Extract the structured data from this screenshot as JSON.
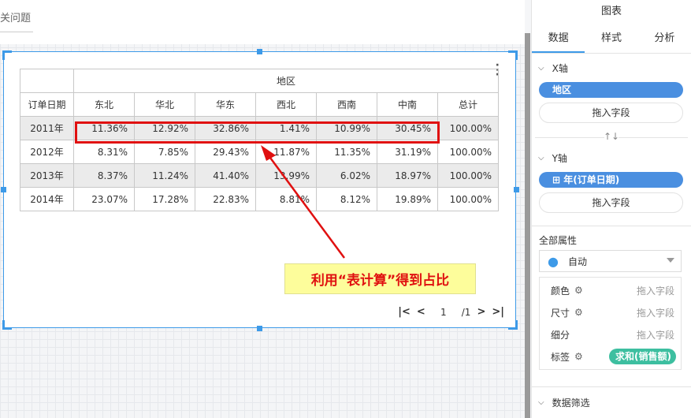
{
  "topbar": {
    "tab_label": "关问题"
  },
  "table": {
    "row_header": "订单日期",
    "column_group": "地区",
    "regions": [
      "东北",
      "华北",
      "华东",
      "西北",
      "西南",
      "中南"
    ],
    "total_label": "总计",
    "rows": [
      {
        "year": "2011年",
        "values": [
          "11.36%",
          "12.92%",
          "32.86%",
          "1.41%",
          "10.99%",
          "30.45%"
        ],
        "total": "100.00%"
      },
      {
        "year": "2012年",
        "values": [
          "8.31%",
          "7.85%",
          "29.43%",
          "11.87%",
          "11.35%",
          "31.19%"
        ],
        "total": "100.00%"
      },
      {
        "year": "2013年",
        "values": [
          "8.37%",
          "11.24%",
          "41.40%",
          "13.99%",
          "6.02%",
          "18.97%"
        ],
        "total": "100.00%"
      },
      {
        "year": "2014年",
        "values": [
          "23.07%",
          "17.28%",
          "22.83%",
          "8.81%",
          "8.12%",
          "19.89%"
        ],
        "total": "100.00%"
      }
    ]
  },
  "pager": {
    "first": "|<",
    "prev": "<",
    "page": "1",
    "of": "/1",
    "next": ">",
    "last": ">|"
  },
  "callout": "利用“表计算”得到占比",
  "panel": {
    "title": "图表",
    "tabs": [
      "数据",
      "样式",
      "分析"
    ],
    "x_axis": {
      "label": "X轴",
      "field": "地区",
      "drop": "拖入字段"
    },
    "swap": "↑↓",
    "y_axis": {
      "label": "Y轴",
      "field": "⊞ 年(订单日期)",
      "drop": "拖入字段"
    },
    "all_props": "全部属性",
    "select_value": "自动",
    "props": [
      {
        "label": "颜色",
        "drop": "拖入字段"
      },
      {
        "label": "尺寸",
        "drop": "拖入字段"
      },
      {
        "label": "细分",
        "drop": "拖入字段"
      },
      {
        "label": "标签",
        "field": "求和(销售额)"
      }
    ],
    "filter": "数据筛选"
  },
  "colors": {
    "accent": "#3d9ae8",
    "highlight": "#e01010",
    "callout_bg": "#fdfd9b",
    "pill_blue": "#4a8fe0",
    "pill_green": "#3dbfa0"
  }
}
